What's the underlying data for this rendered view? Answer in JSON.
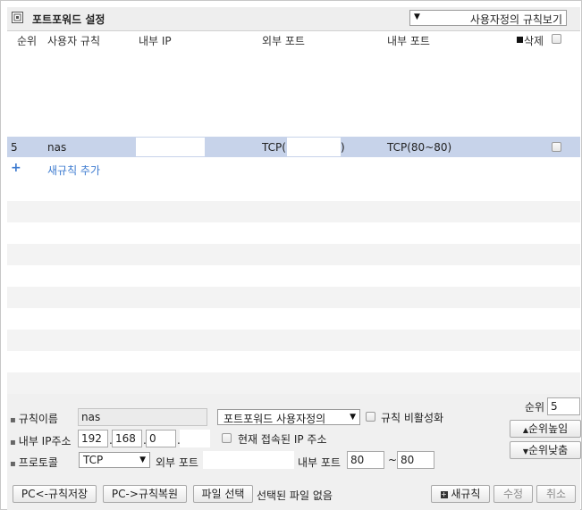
{
  "header": {
    "title": "포트포워드 설정",
    "view_select": "사용자정의 규칙보기"
  },
  "columns": {
    "order": "순위",
    "user_rule": "사용자 규칙",
    "internal_ip": "내부 IP",
    "external_port": "외부 포트",
    "internal_port": "내부 포트",
    "delete": "삭제"
  },
  "rules": [
    {
      "order": "5",
      "name": "nas",
      "internal_ip": "",
      "external_port": "TCP(",
      "external_port_end": ")",
      "internal_port": "TCP(80~80)"
    }
  ],
  "add_rule": {
    "icon": "+",
    "label": "새규칙 추가"
  },
  "form": {
    "rule_name_label": "규칙이름",
    "rule_name_value": "nas",
    "rule_type_select": "포트포워드 사용자정의",
    "disable_rule_label": "규칙 비활성화",
    "internal_ip_label": "내부 IP주소",
    "ip1": "192",
    "ip2": "168",
    "ip3": "0",
    "ip4": "",
    "use_current_ip_label": "현재 접속된 IP 주소",
    "protocol_label": "프로토콜",
    "protocol_value": "TCP",
    "external_port_label": "외부 포트",
    "external_port_value": "",
    "internal_port_label": "내부 포트",
    "internal_port_from": "80",
    "port_sep": "~",
    "internal_port_to": "80",
    "order_label": "순위",
    "order_value": "5",
    "order_up_label": "순위높임",
    "order_down_label": "순위낮춤"
  },
  "actions": {
    "save_to_pc": "PC<-규칙저장",
    "restore_from_pc": "PC->규칙복원",
    "file_select": "파일 선택",
    "no_file": "선택된 파일 없음",
    "new_rule": "새규칙",
    "modify": "수정",
    "cancel": "취소"
  }
}
